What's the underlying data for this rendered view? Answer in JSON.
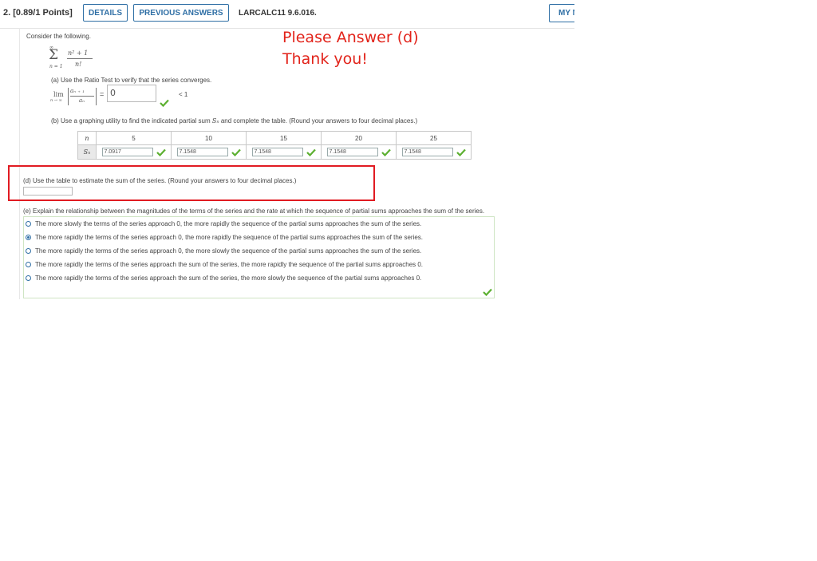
{
  "header": {
    "question_number": "2.  [0.89/1 Points]",
    "details_label": "DETAILS",
    "previous_answers_label": "PREVIOUS ANSWERS",
    "code": "LARCALC11 9.6.016.",
    "my_notes_label": "MY NOTES"
  },
  "note": {
    "line1": "Please Answer (d)",
    "line2": "Thank you!"
  },
  "problem": {
    "intro": "Consider the following.",
    "series_upper": "∞",
    "series_numerator": "n² + 1",
    "series_denominator": "n!",
    "series_lower": "n = 1",
    "part_a": "(a) Use the Ratio Test to verify that the series converges.",
    "lim_label": "lim",
    "lim_sub": "n → ∞",
    "ratio_top": "aₙ ₊ ₁",
    "ratio_bottom": "aₙ",
    "eq": "=",
    "limit_value": "0",
    "less_than": "< 1",
    "part_b_prefix": "(b) Use a graphing utility to find the indicated partial sum ",
    "part_b_sym": "Sₙ",
    "part_b_suffix": " and complete the table. (Round your answers to four decimal places.)",
    "table": {
      "n_label": "n",
      "s_label": "Sₙ",
      "headers": [
        "5",
        "10",
        "15",
        "20",
        "25"
      ],
      "values": [
        "7.0917",
        "7.1548",
        "7.1548",
        "7.1548",
        "7.1548"
      ]
    },
    "part_d": "(d) Use the table to estimate the sum of the series. (Round your answers to four decimal places.)",
    "part_d_value": "",
    "part_e": "(e) Explain the relationship between the magnitudes of the terms of the series and the rate at which the sequence of partial sums approaches the sum of the series.",
    "options": [
      "The more slowly the terms of the series approach 0, the more rapidly the sequence of the partial sums approaches the sum of the series.",
      "The more rapidly the terms of the series approach 0, the more rapidly the sequence of the partial sums approaches the sum of the series.",
      "The more rapidly the terms of the series approach 0, the more slowly the sequence of the partial sums approaches the sum of the series.",
      "The more rapidly the terms of the series approach the sum of the series, the more rapidly the sequence of the partial sums approaches 0.",
      "The more rapidly the terms of the series approach the sum of the series, the more slowly the sequence of the partial sums approaches 0."
    ],
    "selected_option": 1
  },
  "colors": {
    "accent": "#2f6fa5",
    "correct": "#5cb030",
    "note": "#e2231a",
    "highlight": "#e11b22"
  },
  "icons": {
    "correct": "checkmark-icon"
  }
}
